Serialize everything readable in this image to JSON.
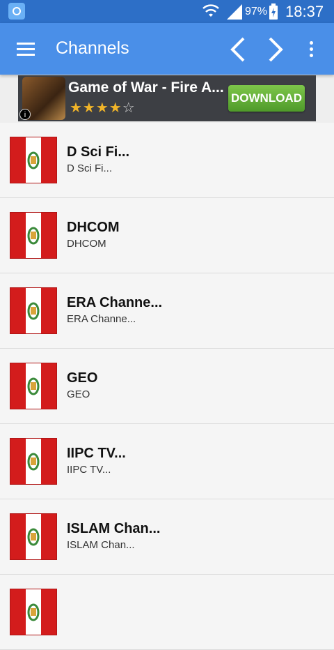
{
  "status_bar": {
    "battery": "97%",
    "time": "18:37",
    "icons": [
      "app-icon",
      "wifi-icon",
      "signal-icon",
      "battery-icon"
    ]
  },
  "app_bar": {
    "title": "Channels",
    "icons": [
      "menu-icon",
      "chevron-left-icon",
      "chevron-right-icon",
      "overflow-icon"
    ],
    "color": "#4a8fe8"
  },
  "ad": {
    "title": "Game of War - Fire A...",
    "rating_stars": 4,
    "rating_max": 5,
    "cta": "DOWNLOAD",
    "info_icon": "i"
  },
  "channels": [
    {
      "title": "D Sci Fi...",
      "subtitle": "D Sci Fi...",
      "icon": "peru-flag-icon"
    },
    {
      "title": "DHCOM",
      "subtitle": "DHCOM",
      "icon": "peru-flag-icon"
    },
    {
      "title": "ERA Channe...",
      "subtitle": "ERA Channe...",
      "icon": "peru-flag-icon"
    },
    {
      "title": "GEO",
      "subtitle": "GEO",
      "icon": "peru-flag-icon"
    },
    {
      "title": "IIPC TV...",
      "subtitle": "IIPC TV...",
      "icon": "peru-flag-icon"
    },
    {
      "title": "ISLAM Chan...",
      "subtitle": "ISLAM Chan...",
      "icon": "peru-flag-icon"
    },
    {
      "title": "",
      "subtitle": "",
      "icon": "peru-flag-icon"
    }
  ]
}
